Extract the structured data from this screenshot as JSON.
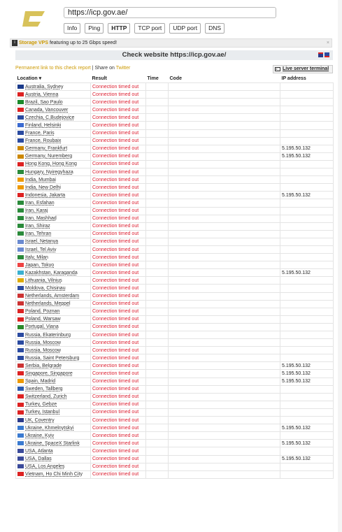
{
  "url": "https://icp.gov.ae/",
  "tabs": [
    {
      "label": "Info",
      "active": false
    },
    {
      "label": "Ping",
      "active": false
    },
    {
      "label": "HTTP",
      "active": true
    },
    {
      "label": "TCP port",
      "active": false
    },
    {
      "label": "UDP port",
      "active": false
    },
    {
      "label": "DNS",
      "active": false
    }
  ],
  "promo": {
    "link": "Storage VPS",
    "text": " featuring up to 25 Gbps speed!",
    "close": "×"
  },
  "header": {
    "title": "Check website  https://icp.gov.ae/"
  },
  "permalink": {
    "link": "Permanent link to this check report",
    "sep": " | Share on ",
    "twitter": "Twitter"
  },
  "terminal": {
    "label": "Live server terminal",
    "icon": ">_"
  },
  "columns": [
    "Location",
    "Result",
    "Time",
    "Code",
    "IP address"
  ],
  "rows": [
    {
      "loc": "Australia, Sydney",
      "res": "Connection timed out",
      "ip": "",
      "flag": "#1a3a8a"
    },
    {
      "loc": "Austria, Vienna",
      "res": "Connection timed out",
      "ip": "",
      "flag": "#d22"
    },
    {
      "loc": "Brazil, Sao Paulo",
      "res": "Connection timed out",
      "ip": "",
      "flag": "#1a8a2a"
    },
    {
      "loc": "Canada, Vancouver",
      "res": "Connection timed out",
      "ip": "",
      "flag": "#d22"
    },
    {
      "loc": "Czechia, C.Budejovice",
      "res": "Connection timed out",
      "ip": "",
      "flag": "#2a4aa0"
    },
    {
      "loc": "Finland, Helsinki",
      "res": "Connection timed out",
      "ip": "",
      "flag": "#3a6ad0"
    },
    {
      "loc": "France, Paris",
      "res": "Connection timed out",
      "ip": "",
      "flag": "#2a4aa0"
    },
    {
      "loc": "France, Roubaix",
      "res": "Connection timed out",
      "ip": "",
      "flag": "#2a4aa0"
    },
    {
      "loc": "Germany, Frankfurt",
      "res": "Connection timed out",
      "ip": "5.195.50.132",
      "flag": "#c80"
    },
    {
      "loc": "Germany, Nuremberg",
      "res": "Connection timed out",
      "ip": "5.195.50.132",
      "flag": "#c80"
    },
    {
      "loc": "Hong Kong, Hong Kong",
      "res": "Connection timed out",
      "ip": "",
      "flag": "#d22"
    },
    {
      "loc": "Hungary, Nyiregyhaza",
      "res": "Connection timed out",
      "ip": "",
      "flag": "#2a8a3a"
    },
    {
      "loc": "India, Mumbai",
      "res": "Connection timed out",
      "ip": "",
      "flag": "#e90"
    },
    {
      "loc": "India, New Delhi",
      "res": "Connection timed out",
      "ip": "",
      "flag": "#e90"
    },
    {
      "loc": "Indonesia, Jakarta",
      "res": "Connection timed out",
      "ip": "5.195.50.132",
      "flag": "#d22"
    },
    {
      "loc": "Iran, Esfahan",
      "res": "Connection timed out",
      "ip": "",
      "flag": "#2a8a3a"
    },
    {
      "loc": "Iran, Karaj",
      "res": "Connection timed out",
      "ip": "",
      "flag": "#2a8a3a"
    },
    {
      "loc": "Iran, Mashhad",
      "res": "Connection timed out",
      "ip": "",
      "flag": "#2a8a3a"
    },
    {
      "loc": "Iran, Shiraz",
      "res": "Connection timed out",
      "ip": "",
      "flag": "#2a8a3a"
    },
    {
      "loc": "Iran, Tehran",
      "res": "Connection timed out",
      "ip": "",
      "flag": "#2a8a3a"
    },
    {
      "loc": "Israel, Netanya",
      "res": "Connection timed out",
      "ip": "",
      "flag": "#6a8ad0"
    },
    {
      "loc": "Israel, Tel Aviv",
      "res": "Connection timed out",
      "ip": "",
      "flag": "#6a8ad0"
    },
    {
      "loc": "Italy, Milan",
      "res": "Connection timed out",
      "ip": "",
      "flag": "#2a8a3a"
    },
    {
      "loc": "Japan, Tokyo",
      "res": "Connection timed out",
      "ip": "",
      "flag": "#e44"
    },
    {
      "loc": "Kazakhstan, Karaganda",
      "res": "Connection timed out",
      "ip": "5.195.50.132",
      "flag": "#3ab0d0"
    },
    {
      "loc": "Lithuania, Vilnius",
      "res": "Connection timed out",
      "ip": "",
      "flag": "#da0"
    },
    {
      "loc": "Moldova, Chisinau",
      "res": "Connection timed out",
      "ip": "",
      "flag": "#2a4aa0"
    },
    {
      "loc": "Netherlands, Amsterdam",
      "res": "Connection timed out",
      "ip": "",
      "flag": "#c33"
    },
    {
      "loc": "Netherlands, Meppel",
      "res": "Connection timed out",
      "ip": "",
      "flag": "#c33"
    },
    {
      "loc": "Poland, Poznan",
      "res": "Connection timed out",
      "ip": "",
      "flag": "#d22"
    },
    {
      "loc": "Poland, Warsaw",
      "res": "Connection timed out",
      "ip": "",
      "flag": "#d22"
    },
    {
      "loc": "Portugal, Viana",
      "res": "Connection timed out",
      "ip": "",
      "flag": "#2a8a2a"
    },
    {
      "loc": "Russia, Ekaterinburg",
      "res": "Connection timed out",
      "ip": "",
      "flag": "#2a4aa0"
    },
    {
      "loc": "Russia, Moscow",
      "res": "Connection timed out",
      "ip": "",
      "flag": "#2a4aa0"
    },
    {
      "loc": "Russia, Moscow",
      "res": "Connection timed out",
      "ip": "",
      "flag": "#2a4aa0"
    },
    {
      "loc": "Russia, Saint Petersburg",
      "res": "Connection timed out",
      "ip": "",
      "flag": "#2a4aa0"
    },
    {
      "loc": "Serbia, Belgrade",
      "res": "Connection timed out",
      "ip": "5.195.50.132",
      "flag": "#c33"
    },
    {
      "loc": "Singapore, Singapore",
      "res": "Connection timed out",
      "ip": "5.195.50.132",
      "flag": "#d22"
    },
    {
      "loc": "Spain, Madrid",
      "res": "Connection timed out",
      "ip": "5.195.50.132",
      "flag": "#e90"
    },
    {
      "loc": "Sweden, Tallberg",
      "res": "Connection timed out",
      "ip": "",
      "flag": "#2a5ab0"
    },
    {
      "loc": "Switzerland, Zurich",
      "res": "Connection timed out",
      "ip": "",
      "flag": "#d22"
    },
    {
      "loc": "Turkey, Gebze",
      "res": "Connection timed out",
      "ip": "",
      "flag": "#d22"
    },
    {
      "loc": "Turkey, Istanbul",
      "res": "Connection timed out",
      "ip": "",
      "flag": "#d22"
    },
    {
      "loc": "UK, Coventry",
      "res": "Connection timed out",
      "ip": "",
      "flag": "#2a3a8a"
    },
    {
      "loc": "Ukraine, Khmelnytskyi",
      "res": "Connection timed out",
      "ip": "5.195.50.132",
      "flag": "#3a7ad0"
    },
    {
      "loc": "Ukraine, Kyiv",
      "res": "Connection timed out",
      "ip": "",
      "flag": "#3a7ad0"
    },
    {
      "loc": "Ukraine, SpaceX Starlink",
      "res": "Connection timed out",
      "ip": "5.195.50.132",
      "flag": "#3a7ad0"
    },
    {
      "loc": "USA, Atlanta",
      "res": "Connection timed out",
      "ip": "",
      "flag": "#3a4a9a"
    },
    {
      "loc": "USA, Dallas",
      "res": "Connection timed out",
      "ip": "5.195.50.132",
      "flag": "#3a4a9a"
    },
    {
      "loc": "USA, Los Angeles",
      "res": "Connection timed out",
      "ip": "",
      "flag": "#3a4a9a"
    },
    {
      "loc": "Vietnam, Ho Chi Minh City",
      "res": "Connection timed out",
      "ip": "",
      "flag": "#d22"
    }
  ]
}
